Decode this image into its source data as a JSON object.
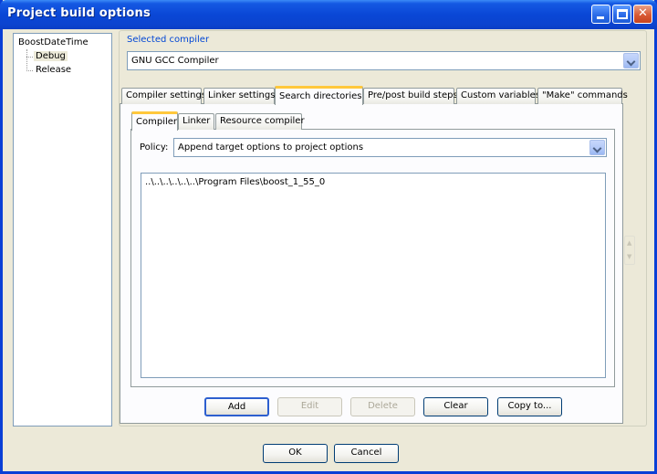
{
  "window": {
    "title": "Project build options"
  },
  "tree": {
    "root": "BoostDateTime",
    "children": [
      {
        "label": "Debug",
        "selected": true
      },
      {
        "label": "Release",
        "selected": false
      }
    ]
  },
  "compiler": {
    "label": "Selected compiler",
    "value": "GNU GCC Compiler"
  },
  "main_tabs": [
    {
      "label": "Compiler settings",
      "active": false
    },
    {
      "label": "Linker settings",
      "active": false
    },
    {
      "label": "Search directories",
      "active": true
    },
    {
      "label": "Pre/post build steps",
      "active": false
    },
    {
      "label": "Custom variables",
      "active": false
    },
    {
      "label": "\"Make\" commands",
      "active": false
    }
  ],
  "sub_tabs": [
    {
      "label": "Compiler",
      "active": true
    },
    {
      "label": "Linker",
      "active": false
    },
    {
      "label": "Resource compiler",
      "active": false
    }
  ],
  "policy": {
    "label": "Policy:",
    "value": "Append target options to project options"
  },
  "directories": [
    "..\\..\\..\\..\\..\\..\\Program Files\\boost_1_55_0"
  ],
  "list_buttons": {
    "add": "Add",
    "edit": "Edit",
    "delete": "Delete",
    "clear": "Clear",
    "copy_to": "Copy to..."
  },
  "dialog_buttons": {
    "ok": "OK",
    "cancel": "Cancel"
  },
  "colors": {
    "titlebar": "#0a47d6",
    "accent_label": "#0046d5",
    "active_tab_highlight": "#ffc83c"
  }
}
